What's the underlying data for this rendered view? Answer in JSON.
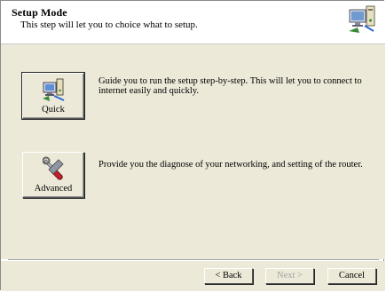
{
  "header": {
    "title": "Setup Mode",
    "subtitle": "This step will let you to choice what to setup."
  },
  "options": [
    {
      "label": "Quick",
      "description_line1": "Guide you to run the setup step-by-step. This will let you to connect to",
      "description_line2": "internet easily and quickly.",
      "icon": "network-wizard-icon"
    },
    {
      "label": "Advanced",
      "description_line1": "Provide you the diagnose of your networking, and setting of the router.",
      "icon": "wrench-tools-icon"
    }
  ],
  "footer": {
    "back_label": "< Back",
    "next_label": "Next >",
    "cancel_label": "Cancel"
  }
}
